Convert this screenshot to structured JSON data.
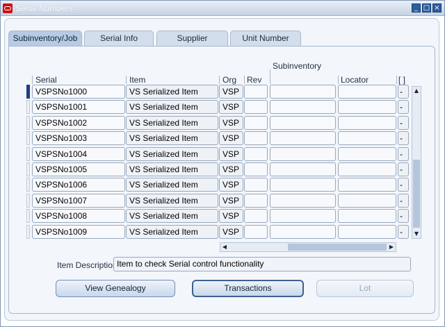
{
  "window": {
    "title": "Serial Numbers"
  },
  "tabs": [
    {
      "label": "Subinventory/Job",
      "active": true
    },
    {
      "label": "Serial Info"
    },
    {
      "label": "Supplier"
    },
    {
      "label": "Unit Number"
    }
  ],
  "columns": {
    "serial": "Serial",
    "item": "Item",
    "org": "Org",
    "rev": "Rev",
    "subinventory": "Subinventory",
    "locator": "Locator",
    "bracket": "[ ]"
  },
  "rows": [
    {
      "serial": "VSPSNo1000",
      "item": "VS Serialized Item",
      "org": "VSP",
      "rev": "",
      "subinventory": "",
      "locator": "",
      "dash": "-"
    },
    {
      "serial": "VSPSNo1001",
      "item": "VS Serialized Item",
      "org": "VSP",
      "rev": "",
      "subinventory": "",
      "locator": "",
      "dash": "-"
    },
    {
      "serial": "VSPSNo1002",
      "item": "VS Serialized Item",
      "org": "VSP",
      "rev": "",
      "subinventory": "",
      "locator": "",
      "dash": "-"
    },
    {
      "serial": "VSPSNo1003",
      "item": "VS Serialized Item",
      "org": "VSP",
      "rev": "",
      "subinventory": "",
      "locator": "",
      "dash": "-"
    },
    {
      "serial": "VSPSNo1004",
      "item": "VS Serialized Item",
      "org": "VSP",
      "rev": "",
      "subinventory": "",
      "locator": "",
      "dash": "-"
    },
    {
      "serial": "VSPSNo1005",
      "item": "VS Serialized Item",
      "org": "VSP",
      "rev": "",
      "subinventory": "",
      "locator": "",
      "dash": "-"
    },
    {
      "serial": "VSPSNo1006",
      "item": "VS Serialized Item",
      "org": "VSP",
      "rev": "",
      "subinventory": "",
      "locator": "",
      "dash": "-"
    },
    {
      "serial": "VSPSNo1007",
      "item": "VS Serialized Item",
      "org": "VSP",
      "rev": "",
      "subinventory": "",
      "locator": "",
      "dash": "-"
    },
    {
      "serial": "VSPSNo1008",
      "item": "VS Serialized Item",
      "org": "VSP",
      "rev": "",
      "subinventory": "",
      "locator": "",
      "dash": "-"
    },
    {
      "serial": "VSPSNo1009",
      "item": "VS Serialized Item",
      "org": "VSP",
      "rev": "",
      "subinventory": "",
      "locator": "",
      "dash": "-"
    }
  ],
  "description": {
    "label": "Item Description",
    "value": "Item to check Serial control functionality"
  },
  "buttons": {
    "view_genealogy": "View Genealogy",
    "transactions": "Transactions",
    "lot": "Lot"
  },
  "icons": {
    "app": "oracle-icon",
    "minimize": "minimize-icon",
    "maximize": "maximize-icon",
    "close": "close-icon"
  }
}
